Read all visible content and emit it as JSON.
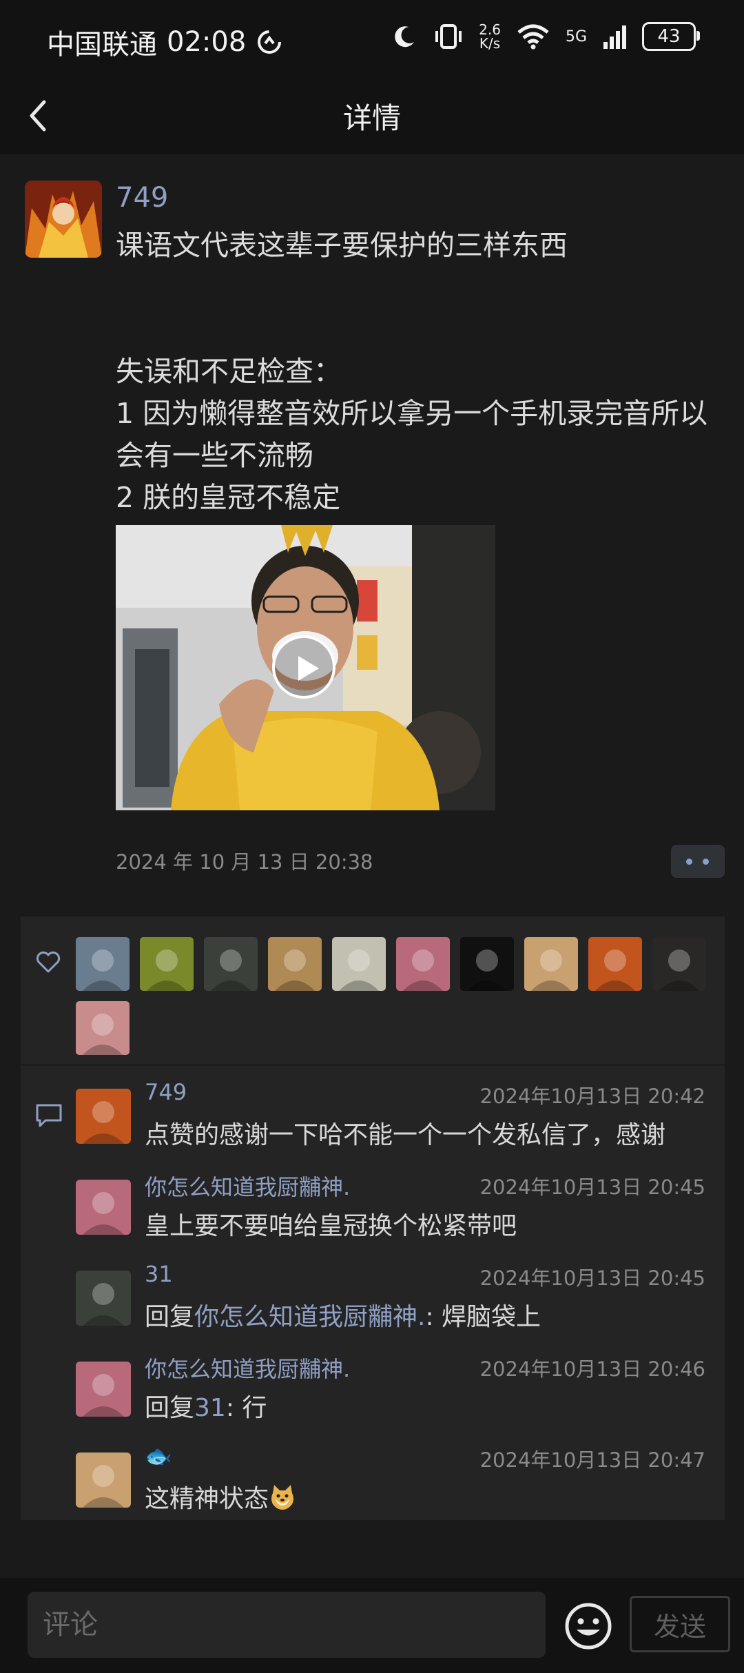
{
  "status_bar": {
    "carrier": "中国联通",
    "time": "02:08",
    "net_speed_top": "2.6",
    "net_speed_bottom": "K/s",
    "network": "5G",
    "battery": "43"
  },
  "header": {
    "title": "详情"
  },
  "post": {
    "author": "749",
    "text": "课语文代表这辈子要保护的三样东西\n\n\n失误和不足检查：\n1 因为懒得整音效所以拿另一个手机录完音所以会有一些不流畅\n2 朕的皇冠不稳定",
    "timestamp": "2024 年 10 月 13 日  20:38"
  },
  "likes": {
    "avatars": [
      {
        "icon": "anime-boy-avatar",
        "color": "#6a7d8f"
      },
      {
        "icon": "butterflies-avatar",
        "color": "#7a8a2a"
      },
      {
        "icon": "fur-avatar",
        "color": "#3b403a"
      },
      {
        "icon": "dog-avatar",
        "color": "#b08a55"
      },
      {
        "icon": "cartoon-avatar",
        "color": "#c2c0b0"
      },
      {
        "icon": "anime-girl-avatar",
        "color": "#b86a7a"
      },
      {
        "icon": "dark-avatar",
        "color": "#101010"
      },
      {
        "icon": "flower-avatar",
        "color": "#c9a070"
      },
      {
        "icon": "fire-warrior-avatar",
        "color": "#c2541e"
      },
      {
        "icon": "long-hair-avatar",
        "color": "#2a2826"
      },
      {
        "icon": "painting-avatar",
        "color": "#c98c8c"
      }
    ]
  },
  "comments": [
    {
      "name": "749",
      "time": "2024年10月13日 20:42",
      "reply_to": "",
      "text": "点赞的感谢一下哈不能一个一个发私信了，感谢",
      "avatar_color": "#c2541e",
      "avatar_icon": "fire-warrior-avatar"
    },
    {
      "name": "你怎么知道我厨黼神.",
      "time": "2024年10月13日 20:45",
      "reply_to": "",
      "text": "皇上要不要咱给皇冠换个松紧带吧",
      "avatar_color": "#b86a7a",
      "avatar_icon": "anime-girl-avatar"
    },
    {
      "name": "31",
      "time": "2024年10月13日 20:45",
      "reply_prefix": "回复",
      "reply_to": "你怎么知道我厨黼神.",
      "text": ": 焊脑袋上",
      "avatar_color": "#3b403a",
      "avatar_icon": "fur-avatar"
    },
    {
      "name": "你怎么知道我厨黼神.",
      "time": "2024年10月13日 20:46",
      "reply_prefix": "回复",
      "reply_to": "31",
      "text": ": 行",
      "avatar_color": "#b86a7a",
      "avatar_icon": "anime-girl-avatar"
    },
    {
      "name": "🐟",
      "time": "2024年10月13日 20:47",
      "reply_to": "",
      "text": "这精神状态",
      "avatar_color": "#c9a070",
      "avatar_icon": "flower-avatar"
    }
  ],
  "bottom_bar": {
    "comment_placeholder": "评论",
    "send_label": "发送"
  }
}
